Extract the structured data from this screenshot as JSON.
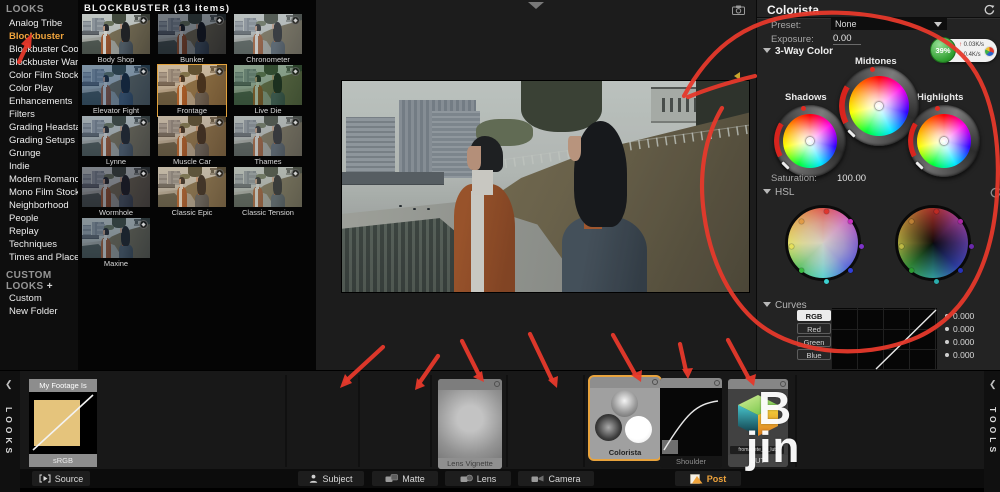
{
  "sidebar": {
    "header": "LOOKS",
    "items": [
      "Analog Tribe",
      "Blockbuster",
      "Blockbuster Cool",
      "Blockbuster Warm",
      "Color Film Stock",
      "Color Play",
      "Enhancements",
      "Filters",
      "Grading Headstarts",
      "Grading Setups",
      "Grunge",
      "Indie",
      "Modern Romance",
      "Mono Film Stock",
      "Neighborhood",
      "People",
      "Replay",
      "Techniques",
      "Times and Places"
    ],
    "active_item": "Blockbuster",
    "custom_header": "CUSTOM LOOKS",
    "custom_add": "+",
    "custom_items": [
      "Custom",
      "New Folder"
    ]
  },
  "browser": {
    "title": "BLOCKBUSTER (13 items)",
    "selected": "Frontage",
    "items": [
      {
        "name": "Body Shop",
        "tint": "rgba(120,130,140,0.12)"
      },
      {
        "name": "Bunker",
        "tint": "rgba(8,18,38,0.45)"
      },
      {
        "name": "Chronometer",
        "tint": "rgba(150,160,170,0.30)"
      },
      {
        "name": "Elevator Fight",
        "tint": "rgba(18,60,110,0.42)"
      },
      {
        "name": "Frontage",
        "tint": "rgba(205,125,45,0.28)"
      },
      {
        "name": "Live Die",
        "tint": "rgba(40,90,45,0.40)"
      },
      {
        "name": "Lynne",
        "tint": "rgba(60,80,110,0.30)"
      },
      {
        "name": "Muscle Car",
        "tint": "rgba(165,110,60,0.30)"
      },
      {
        "name": "Thames",
        "tint": "rgba(120,126,132,0.35)"
      },
      {
        "name": "Wormhole",
        "tint": "rgba(28,32,50,0.45)"
      },
      {
        "name": "Classic Epic",
        "tint": "rgba(175,130,80,0.30)"
      },
      {
        "name": "Classic Tension",
        "tint": "rgba(128,134,124,0.35)"
      },
      {
        "name": "Maxine",
        "tint": "rgba(38,58,80,0.40)"
      }
    ]
  },
  "colorista": {
    "title": "Colorista",
    "preset_label": "Preset:",
    "preset_value": "None",
    "exposure_label": "Exposure:",
    "exposure_value": "0.00",
    "three_way_label": "3-Way Color",
    "wheel_labels": [
      "Shadows",
      "Midtones",
      "Highlights"
    ],
    "saturation_label": "Saturation:",
    "saturation_value": "100.00",
    "hsl_label": "HSL",
    "hsl_dot_colors": [
      "#ff2d24",
      "#e326d8",
      "#8a2de8",
      "#2b3cff",
      "#1fd9d9",
      "#23c32c",
      "#e8e23c",
      "#f0992e"
    ],
    "curves_label": "Curves",
    "curve_channels": [
      "RGB",
      "Red",
      "Green",
      "Blue"
    ],
    "curve_active": "RGB",
    "curve_values": [
      "0.000",
      "0.000",
      "0.000",
      "0.000"
    ]
  },
  "net_badge": {
    "percent": "39%",
    "up": "0.03K/s",
    "down": "0.4K/s"
  },
  "bottom": {
    "looks_strip": "LOOKS",
    "tools_strip": "TOOLS",
    "collapse_glyph": "❮",
    "footage_card": {
      "title": "My Footage Is",
      "label": "sRGB"
    },
    "source_button": "Source",
    "group_buttons": [
      "Subject",
      "Matte",
      "Lens",
      "Camera",
      "Post"
    ],
    "cards": {
      "lens_vignette": "Lens Vignette",
      "colorista": "Colorista",
      "shoulder": "Shoulder",
      "lut": "LUT",
      "lut_filename": "fromagete_id_lut"
    }
  },
  "watermark": {
    "line1": "B",
    "line2": "jin"
  },
  "accents": {
    "selection_orange": "#e8a33d",
    "annotation_red": "#e6392b"
  }
}
